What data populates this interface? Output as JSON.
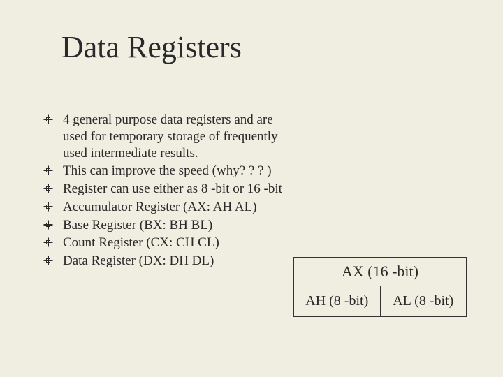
{
  "title": "Data Registers",
  "bullets": [
    "4 general purpose data registers and are used for temporary storage of frequently used intermediate results.",
    "This can improve the speed (why? ? ? )",
    "Register can use either as 8 -bit or 16 -bit",
    "Accumulator Register (AX: AH AL)",
    "Base Register (BX: BH BL)",
    "Count Register (CX: CH CL)",
    "Data Register (DX: DH DL)"
  ],
  "diagram": {
    "top": "AX (16 -bit)",
    "left": "AH (8 -bit)",
    "right": "AL (8 -bit)"
  }
}
